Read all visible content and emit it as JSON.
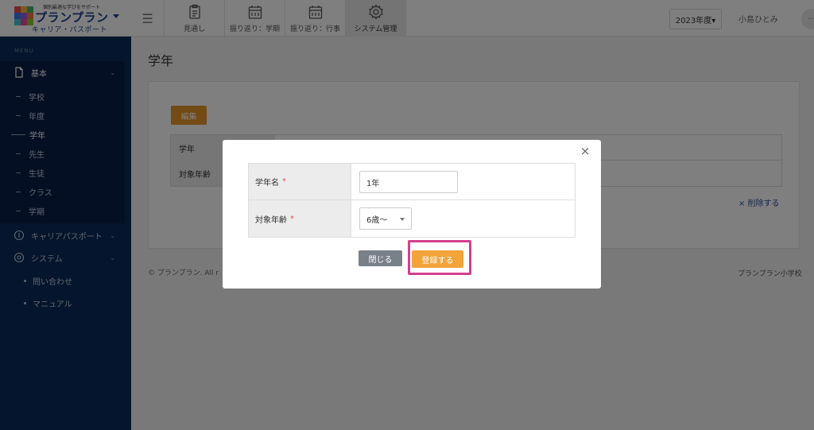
{
  "header": {
    "logo_tagline": "個別最適な学びをサポート",
    "logo_title": "プランプラン",
    "logo_subtitle": "キャリア・パスポート",
    "nav": [
      {
        "label": "見通し",
        "icon": "clipboard-icon"
      },
      {
        "label": "振り返り：学期",
        "icon": "calendar-icon"
      },
      {
        "label": "振り返り：行事",
        "icon": "calendar-icon"
      },
      {
        "label": "システム管理",
        "icon": "gear-icon"
      }
    ],
    "year_selector": "2023年度▾",
    "user_name": "小島ひとみ",
    "more": "···"
  },
  "sidebar": {
    "menu_label": "MENU",
    "basic": {
      "label": "基本",
      "icon": "document-icon",
      "chevron": "⌄"
    },
    "basic_items": [
      "学校",
      "年度",
      "学年",
      "先生",
      "生徒",
      "クラス",
      "学期"
    ],
    "active_item": "学年",
    "career": {
      "label": "キャリアパスポート",
      "icon": "circle-one-icon",
      "chevron": "⌄"
    },
    "system": {
      "label": "システム",
      "icon": "gear-icon",
      "chevron": "⌄"
    },
    "links": [
      "問い合わせ",
      "マニュアル"
    ]
  },
  "main": {
    "page_title": "学年",
    "edit_button": "編集",
    "rows": [
      {
        "label": "学年"
      },
      {
        "label": "対象年齢"
      }
    ],
    "delete_link": "× 削除する",
    "footer_left": "© プランプラン. All r",
    "footer_right": "プランプラン小学校"
  },
  "modal": {
    "close_icon": "×",
    "fields": [
      {
        "label": "学年名",
        "required": "*",
        "value": "1年"
      },
      {
        "label": "対象年齢",
        "required": "*",
        "value": "6歳〜"
      }
    ],
    "close_button": "閉じる",
    "submit_button": "登録する"
  },
  "colors": {
    "sidebar": "#0b2a5b",
    "accent_orange": "#f2a33a",
    "highlight_pink": "#d43f8d",
    "gray_button": "#7a8088"
  }
}
